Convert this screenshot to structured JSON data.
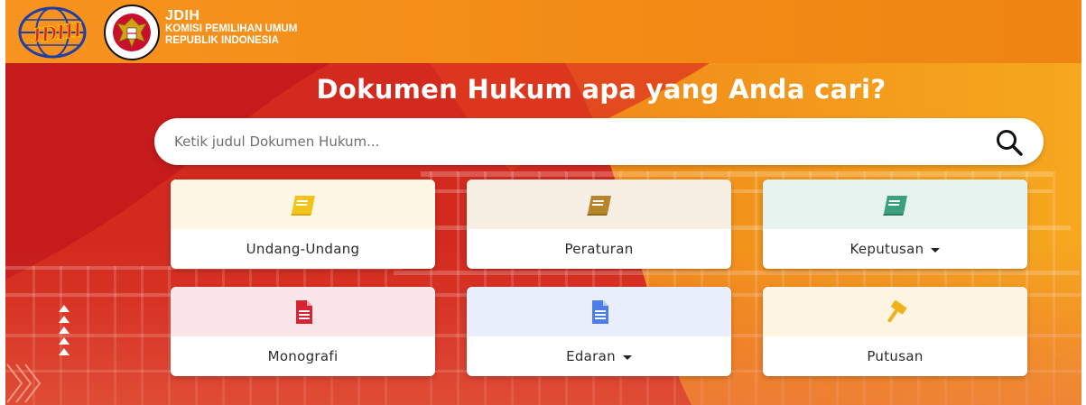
{
  "header": {
    "title": "JDIH",
    "subtitle_line1": "KOMISI PEMILIHAN UMUM",
    "subtitle_line2": "REPUBLIK INDONESIA",
    "logo_jdih_text": "JDIH",
    "logo_kpu_text": "KOMISI PEMILIHAN UMUM"
  },
  "hero": {
    "title": "Dokumen Hukum apa yang Anda cari?"
  },
  "search": {
    "placeholder": "Ketik judul Dokumen Hukum..."
  },
  "categories": [
    {
      "label": "Undang-Undang",
      "icon": "book-icon",
      "icon_color": "#f2c318",
      "bg": "#fdf7e3",
      "dropdown": false
    },
    {
      "label": "Peraturan",
      "icon": "book-icon",
      "icon_color": "#b8862a",
      "bg": "#f7efe3",
      "dropdown": false
    },
    {
      "label": "Keputusan",
      "icon": "book-icon",
      "icon_color": "#3aa07d",
      "bg": "#e6f3ee",
      "dropdown": true
    },
    {
      "label": "Monografi",
      "icon": "document-icon",
      "icon_color": "#d62436",
      "bg": "#fae6e8",
      "dropdown": false
    },
    {
      "label": "Edaran",
      "icon": "document-icon",
      "icon_color": "#4c7fe6",
      "bg": "#e8eefc",
      "dropdown": true
    },
    {
      "label": "Putusan",
      "icon": "gavel-icon",
      "icon_color": "#f0b21b",
      "bg": "#fdf5e2",
      "dropdown": false
    }
  ],
  "colors": {
    "header_orange": "#f28c17",
    "hero_red": "#d0231f",
    "hero_yellow": "#f5a31c"
  }
}
